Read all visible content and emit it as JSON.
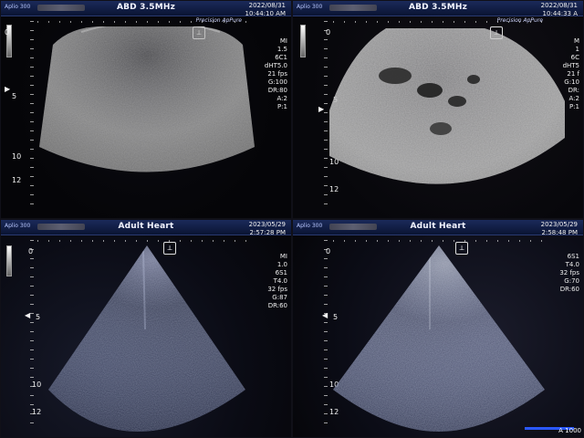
{
  "panels": [
    {
      "id": "top-left",
      "system": "Aplio 300",
      "title": "ABD 3.5MHz",
      "date": "2022/08/31",
      "time": "10:44:10 AM",
      "modes": "Precision  ApPure",
      "depth_labels": [
        "0",
        "5",
        "10",
        "12"
      ],
      "params": [
        "MI",
        "1.5",
        "6C1",
        "dHT5.0",
        "21 fps",
        "",
        "G:100",
        "DR:80",
        "A:2",
        "P:1"
      ],
      "probe_icon": "probe-icon"
    },
    {
      "id": "top-right",
      "system": "Aplio 300",
      "title": "ABD 3.5MHz",
      "date": "2022/08/31",
      "time": "10:44:33 A",
      "modes": "Precision  ApPure",
      "depth_labels": [
        "0",
        "5",
        "10",
        "12"
      ],
      "params": [
        "M",
        "1",
        "6C",
        "dHT5",
        "21 f",
        "",
        "G:10",
        "DR:",
        "A:2",
        "P:1"
      ],
      "probe_icon": "probe-icon"
    },
    {
      "id": "bottom-left",
      "system": "Aplio 300",
      "title": "Adult Heart",
      "date": "2023/05/29",
      "time": "2:57:28 PM",
      "modes": "",
      "depth_labels": [
        "0",
        "5",
        "10",
        "12"
      ],
      "params": [
        "MI",
        "1.0",
        "6S1",
        "T4.0",
        "32 fps",
        "",
        "G:87",
        "DR:60"
      ],
      "probe_icon": "probe-icon"
    },
    {
      "id": "bottom-right",
      "system": "Aplio 300",
      "title": "Adult Heart",
      "date": "2023/05/29",
      "time": "2:58:48 PM",
      "modes": "",
      "depth_labels": [
        "0",
        "5",
        "10",
        "12"
      ],
      "params": [
        "",
        "",
        "6S1",
        "T4.0",
        "32 fps",
        "",
        "G:70",
        "DR:60"
      ],
      "probe_icon": "probe-icon"
    }
  ],
  "footer": {
    "zoom": "A 1000"
  },
  "colors": {
    "topbar": "#0a1433",
    "accent_blue": "#2a58ff"
  }
}
